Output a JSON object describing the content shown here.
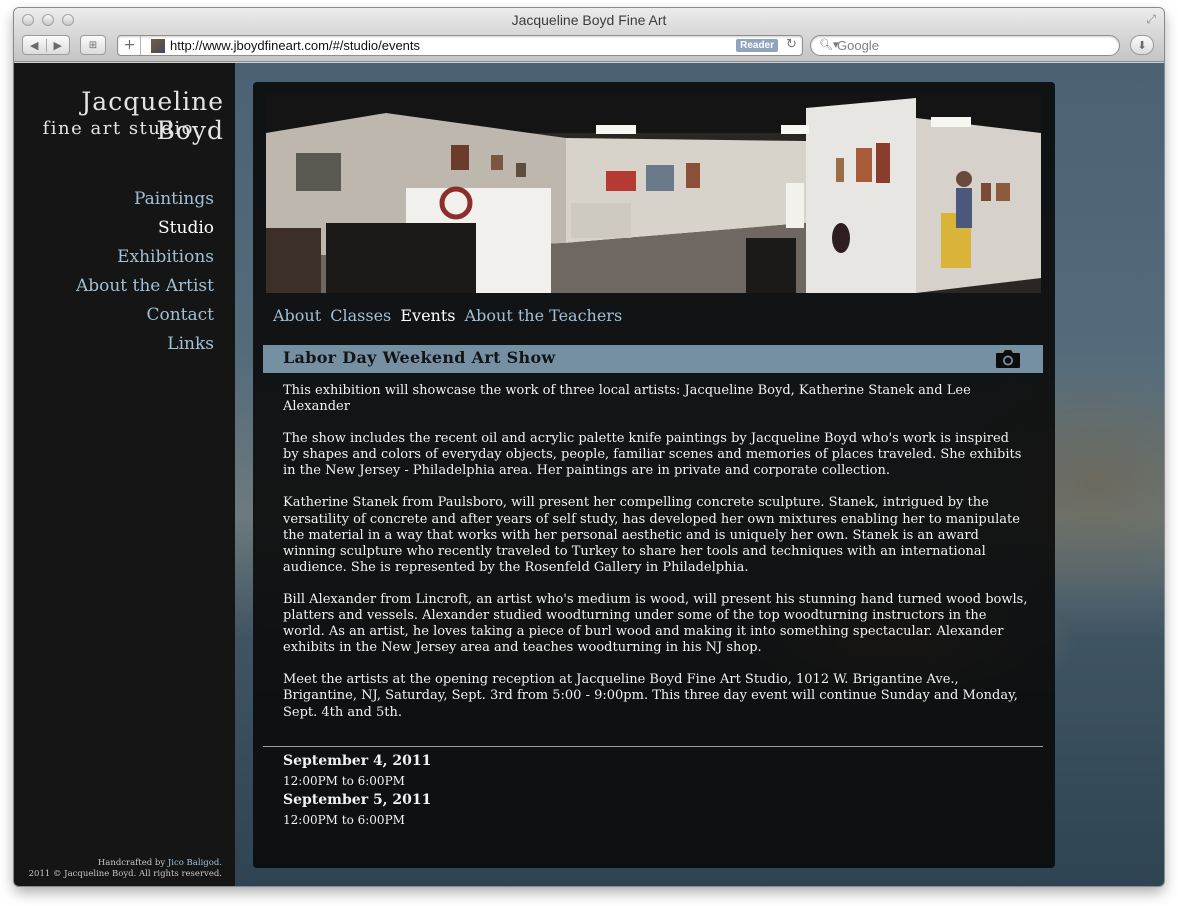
{
  "browser": {
    "window_title": "Jacqueline Boyd Fine Art",
    "url": "http://www.jboydfineart.com/#/studio/events",
    "reader_label": "Reader",
    "search_placeholder": "Google"
  },
  "site": {
    "logo_name": "Jacqueline Boyd",
    "logo_sub": "fine art studio",
    "nav": [
      {
        "label": "Paintings",
        "active": false
      },
      {
        "label": "Studio",
        "active": true
      },
      {
        "label": "Exhibitions",
        "active": false
      },
      {
        "label": "About the Artist",
        "active": false
      },
      {
        "label": "Contact",
        "active": false
      },
      {
        "label": "Links",
        "active": false
      }
    ],
    "footer": {
      "credit_prefix": "Handcrafted by",
      "credit_name": "Jico Baligod.",
      "copyright": "2011 © Jacqueline Boyd. All rights reserved."
    }
  },
  "studio": {
    "subnav": [
      {
        "label": "About",
        "active": false
      },
      {
        "label": "Classes",
        "active": false
      },
      {
        "label": "Events",
        "active": true
      },
      {
        "label": "About the Teachers",
        "active": false
      }
    ],
    "event": {
      "title": "Labor Day Weekend Art Show",
      "paragraphs": [
        "This exhibition will showcase the work of three local artists: Jacqueline Boyd, Katherine Stanek and Lee Alexander",
        "The show includes the recent oil and acrylic palette knife paintings by Jacqueline Boyd who's work is inspired by shapes and colors of everyday objects, people, familiar scenes and memories of places traveled. She exhibits in the New Jersey - Philadelphia area. Her paintings are in private and corporate collection.",
        "Katherine Stanek from Paulsboro, will present her compelling concrete sculpture. Stanek, intrigued by the versatility of concrete and after years of self study, has developed her own mixtures enabling her to manipulate the material in a way that works with her personal aesthetic and is uniquely her own. Stanek is an award winning sculpture who recently traveled to Turkey to share her tools and techniques with an international audience. She is represented by the Rosenfeld Gallery in Philadelphia.",
        "Bill Alexander from Lincroft, an artist who's medium is wood, will present his stunning hand turned wood bowls, platters and vessels. Alexander studied woodturning under some of the top woodturning instructors in the world. As an artist, he loves taking a piece of burl wood and making it into something spectacular. Alexander exhibits in the New Jersey area and teaches woodturning in his NJ shop.",
        "Meet the artists at the opening reception at Jacqueline Boyd Fine Art Studio, 1012 W. Brigantine Ave., Brigantine, NJ, Saturday, Sept. 3rd from 5:00 - 9:00pm. This three day event will continue Sunday and Monday, Sept. 4th and 5th."
      ],
      "dates": [
        {
          "date": "September 4, 2011",
          "time": "12:00PM to 6:00PM"
        },
        {
          "date": "September 5, 2011",
          "time": "12:00PM to 6:00PM"
        }
      ]
    }
  },
  "colors": {
    "link": "#9fc0d6",
    "active_link": "#ffffff",
    "event_header": "#7690a3",
    "sidebar_bg": "#151515"
  },
  "icons": [
    "back-icon",
    "forward-icon",
    "add-bookmark-icon",
    "reload-icon",
    "search-icon",
    "downloads-icon",
    "fullscreen-icon",
    "camera-icon"
  ]
}
